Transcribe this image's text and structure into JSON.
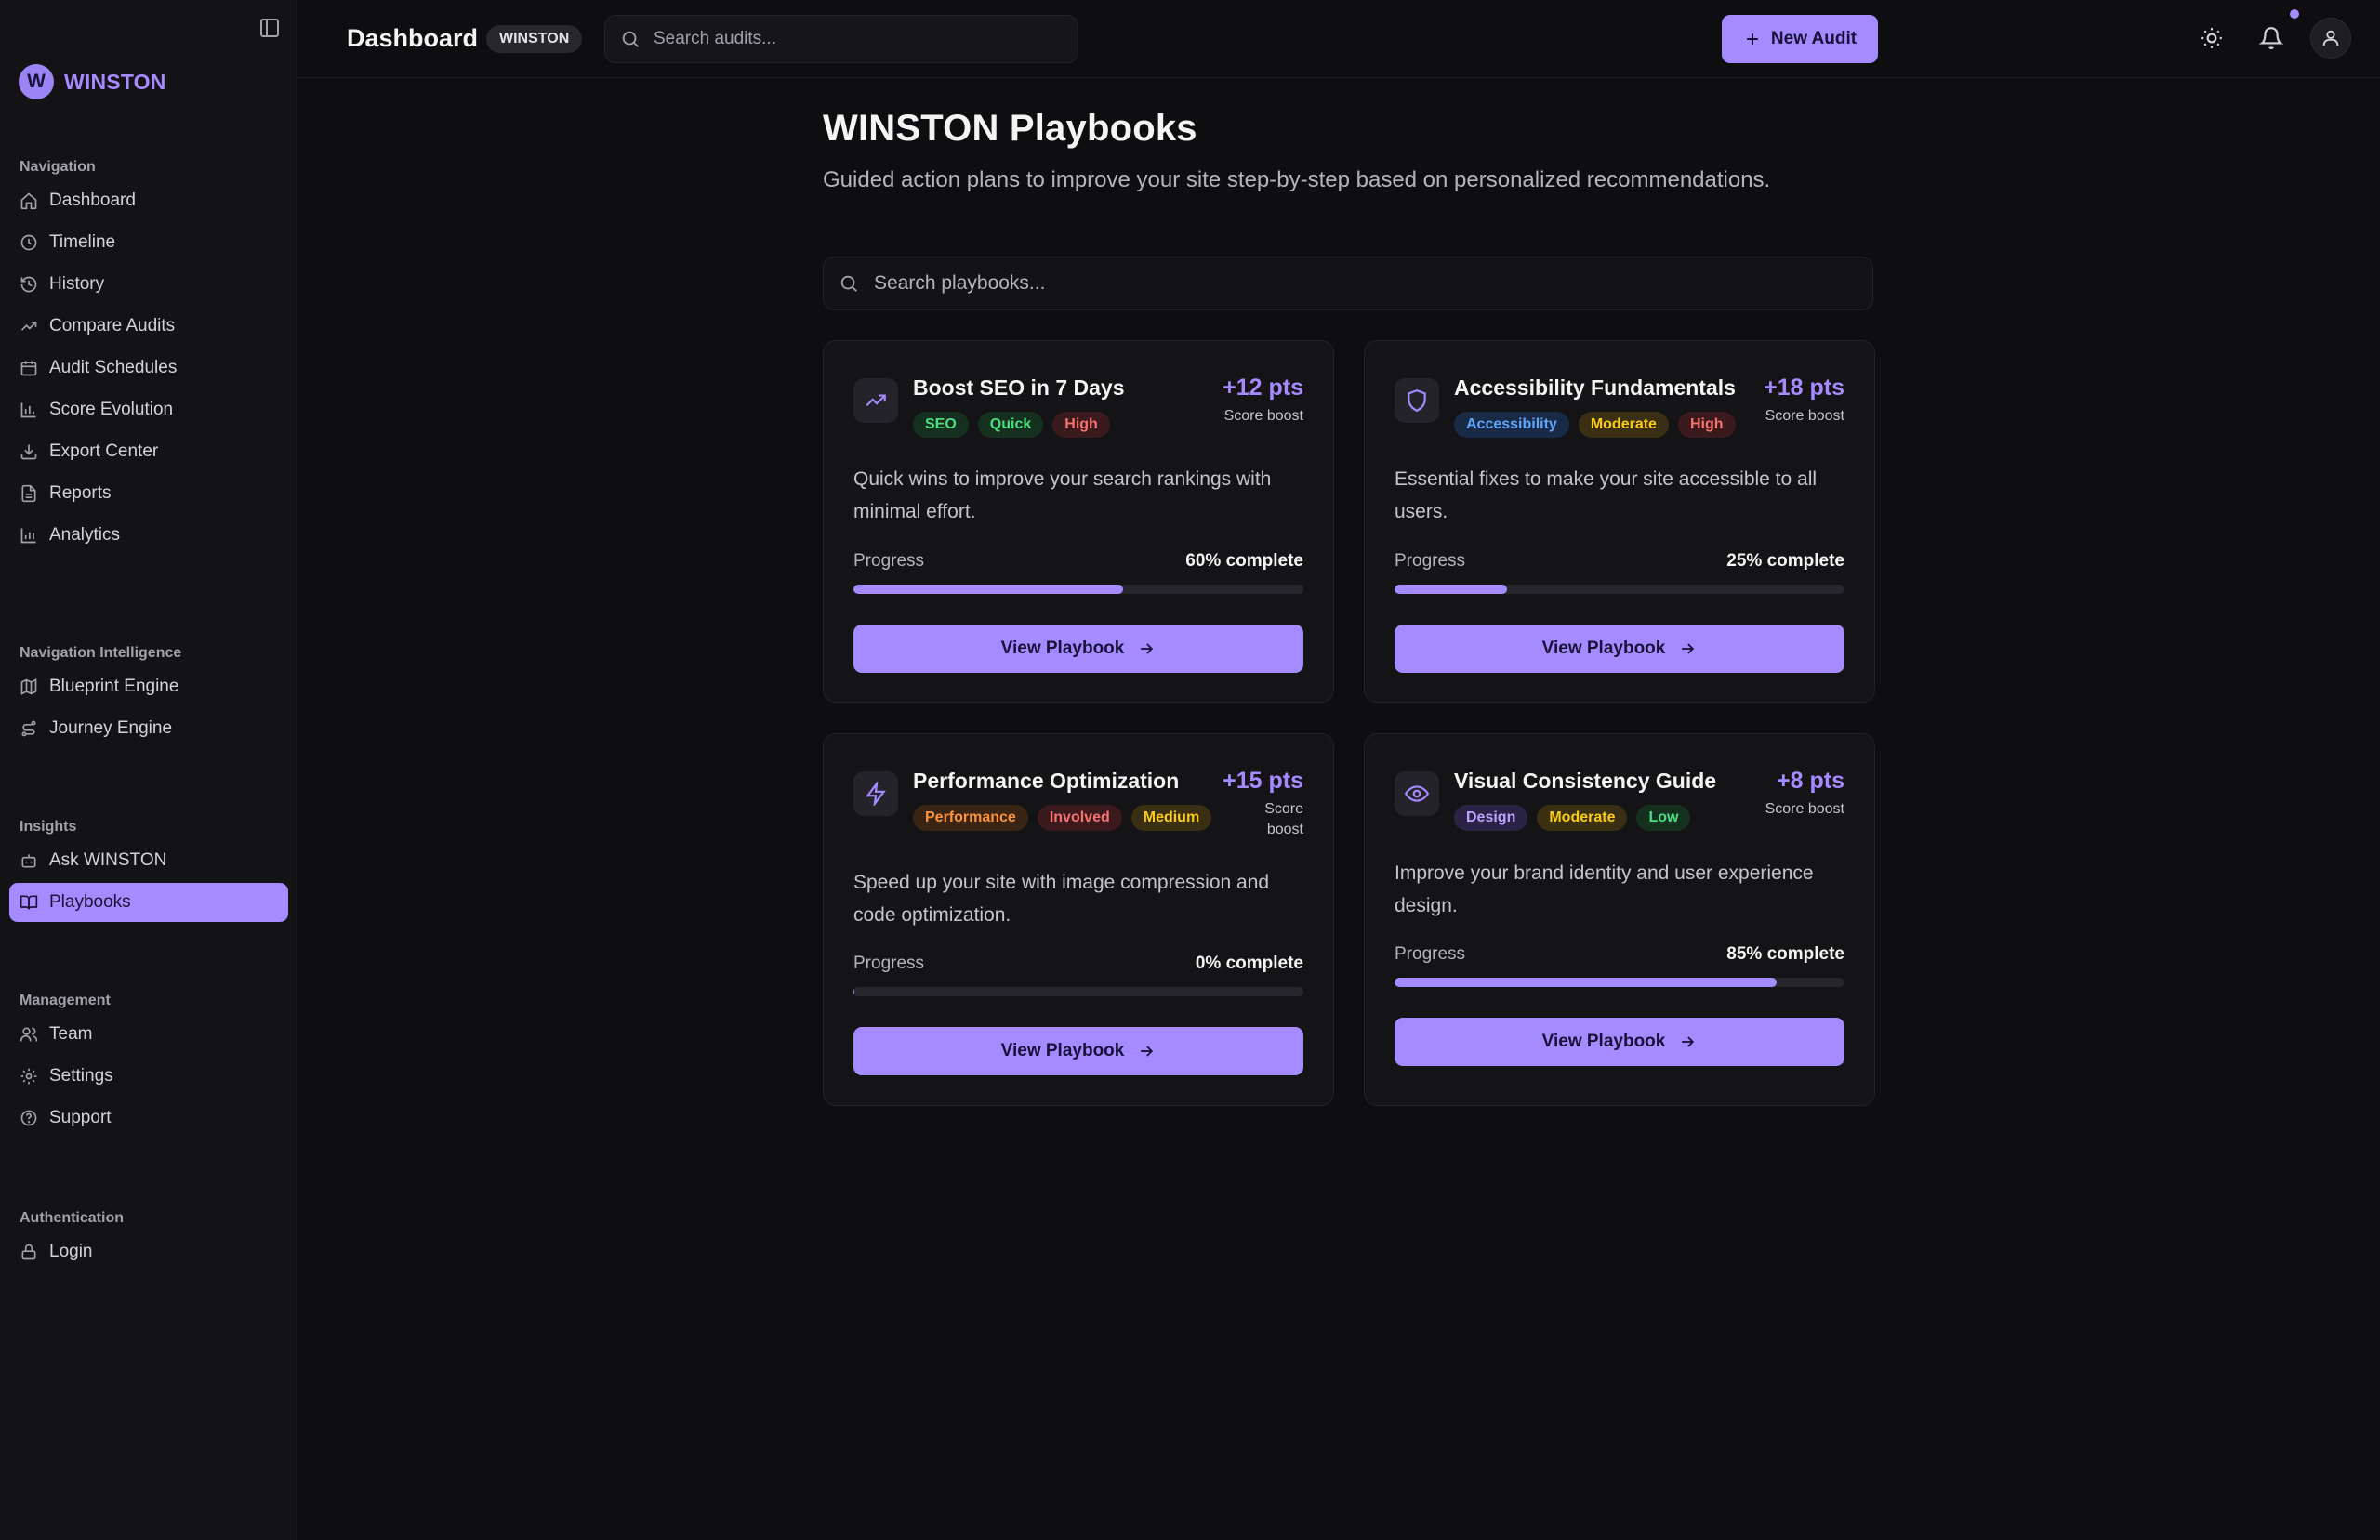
{
  "app": {
    "brand_initial": "W",
    "brand_name": "WINSTON"
  },
  "sidebar": {
    "groups": [
      {
        "title": "Navigation",
        "items": [
          {
            "label": "Dashboard",
            "icon": "home-icon"
          },
          {
            "label": "Timeline",
            "icon": "clock-icon"
          },
          {
            "label": "History",
            "icon": "history-icon"
          },
          {
            "label": "Compare Audits",
            "icon": "trend-icon"
          },
          {
            "label": "Audit Schedules",
            "icon": "calendar-icon"
          },
          {
            "label": "Score Evolution",
            "icon": "bar-chart-icon"
          },
          {
            "label": "Export Center",
            "icon": "download-icon"
          },
          {
            "label": "Reports",
            "icon": "file-icon"
          },
          {
            "label": "Analytics",
            "icon": "bar-chart-icon"
          }
        ]
      },
      {
        "title": "Navigation Intelligence",
        "items": [
          {
            "label": "Blueprint Engine",
            "icon": "map-icon"
          },
          {
            "label": "Journey Engine",
            "icon": "route-icon"
          }
        ]
      },
      {
        "title": "Insights",
        "items": [
          {
            "label": "Ask WINSTON",
            "icon": "bot-icon"
          },
          {
            "label": "Playbooks",
            "icon": "book-icon",
            "active": true
          }
        ]
      },
      {
        "title": "Management",
        "items": [
          {
            "label": "Team",
            "icon": "users-icon"
          },
          {
            "label": "Settings",
            "icon": "gear-icon"
          },
          {
            "label": "Support",
            "icon": "help-icon"
          }
        ]
      },
      {
        "title": "Authentication",
        "items": [
          {
            "label": "Login",
            "icon": "lock-icon"
          }
        ]
      }
    ]
  },
  "topbar": {
    "title": "Dashboard",
    "badge": "WINSTON",
    "search_placeholder": "Search audits...",
    "new_audit_label": "New Audit"
  },
  "main": {
    "title": "WINSTON Playbooks",
    "subtitle": "Guided action plans to improve your site step-by-step based on personalized recommendations.",
    "search_placeholder": "Search playbooks...",
    "progress_label": "Progress",
    "button_label": "View Playbook",
    "boost_label": "Score boost"
  },
  "playbooks": [
    {
      "title": "Boost SEO in 7 Days",
      "icon": "trending-up-icon",
      "tags": [
        {
          "label": "SEO",
          "color": "green"
        },
        {
          "label": "Quick",
          "color": "green"
        },
        {
          "label": "High",
          "color": "red"
        }
      ],
      "points": "+12 pts",
      "description": "Quick wins to improve your search rankings with minimal effort.",
      "progress": 60,
      "progress_text": "60% complete"
    },
    {
      "title": "Accessibility Fundamentals",
      "icon": "shield-icon",
      "tags": [
        {
          "label": "Accessibility",
          "color": "blue"
        },
        {
          "label": "Moderate",
          "color": "yellow"
        },
        {
          "label": "High",
          "color": "red"
        }
      ],
      "points": "+18 pts",
      "description": "Essential fixes to make your site accessible to all users.",
      "progress": 25,
      "progress_text": "25% complete"
    },
    {
      "title": "Performance Optimization",
      "icon": "zap-icon",
      "tags": [
        {
          "label": "Performance",
          "color": "orange"
        },
        {
          "label": "Involved",
          "color": "red"
        },
        {
          "label": "Medium",
          "color": "yellow"
        }
      ],
      "points": "+15 pts",
      "description": "Speed up your site with image compression and code optimization.",
      "progress": 0,
      "progress_text": "0% complete"
    },
    {
      "title": "Visual Consistency Guide",
      "icon": "eye-icon",
      "tags": [
        {
          "label": "Design",
          "color": "purple"
        },
        {
          "label": "Moderate",
          "color": "yellow"
        },
        {
          "label": "Low",
          "color": "green"
        }
      ],
      "points": "+8 pts",
      "description": "Improve your brand identity and user experience design.",
      "progress": 85,
      "progress_text": "85% complete"
    }
  ],
  "colors": {
    "accent": "#a48bff",
    "background": "#0e0e11",
    "card": "#141417"
  }
}
